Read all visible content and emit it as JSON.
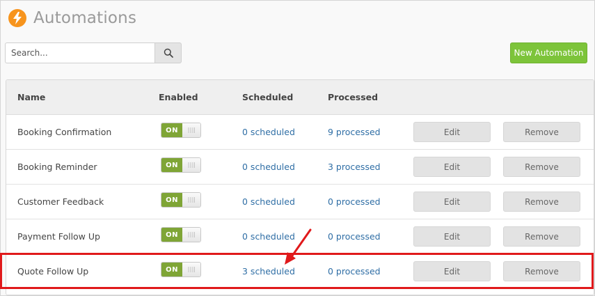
{
  "header": {
    "title": "Automations",
    "logo_icon": "lightning-bolt-icon",
    "logo_color": "#f7941d"
  },
  "search": {
    "placeholder": "Search...",
    "value": "",
    "icon": "search-icon"
  },
  "toolbar": {
    "new_label": "New Automation",
    "new_color": "#7dc43a"
  },
  "table": {
    "columns": [
      "Name",
      "Enabled",
      "Scheduled",
      "Processed"
    ],
    "rows": [
      {
        "name": "Booking Confirmation",
        "enabled": "ON",
        "scheduled": "0 scheduled",
        "processed": "9 processed",
        "edit": "Edit",
        "remove": "Remove"
      },
      {
        "name": "Booking Reminder",
        "enabled": "ON",
        "scheduled": "0 scheduled",
        "processed": "3 processed",
        "edit": "Edit",
        "remove": "Remove"
      },
      {
        "name": "Customer Feedback",
        "enabled": "ON",
        "scheduled": "0 scheduled",
        "processed": "0 processed",
        "edit": "Edit",
        "remove": "Remove"
      },
      {
        "name": "Payment Follow Up",
        "enabled": "ON",
        "scheduled": "0 scheduled",
        "processed": "0 processed",
        "edit": "Edit",
        "remove": "Remove"
      },
      {
        "name": "Quote Follow Up",
        "enabled": "ON",
        "scheduled": "3 scheduled",
        "processed": "0 processed",
        "edit": "Edit",
        "remove": "Remove"
      }
    ]
  },
  "colors": {
    "toggle_on": "#7fa536",
    "link": "#2f6ea5",
    "highlight": "#e0191b"
  }
}
